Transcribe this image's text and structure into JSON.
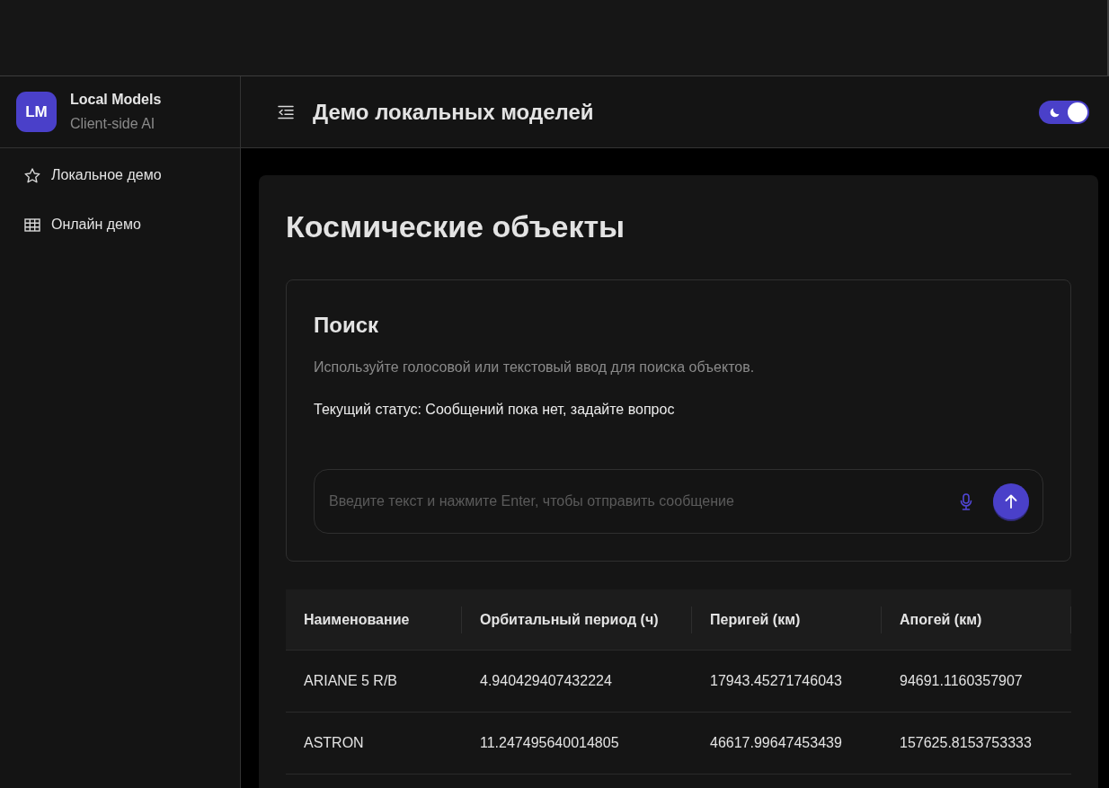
{
  "sidebar": {
    "logo": {
      "initials": "LM",
      "title": "Local Models",
      "subtitle": "Client-side AI"
    },
    "items": [
      {
        "label": "Локальное демо"
      },
      {
        "label": "Онлайн демо"
      }
    ]
  },
  "header": {
    "title": "Демо локальных моделей",
    "theme_toggle": {
      "on": true
    }
  },
  "page": {
    "heading": "Космические объекты",
    "search": {
      "title": "Поиск",
      "description": "Используйте голосовой или текстовый ввод для поиска объектов.",
      "status": "Текущий статус: Сообщений пока нет, задайте вопрос",
      "input": {
        "placeholder": "Введите текст и нажмите Enter, чтобы отправить сообщение"
      }
    },
    "table": {
      "columns": [
        "Наименование",
        "Орбитальный период (ч)",
        "Перигей (км)",
        "Апогей (км)"
      ],
      "rows": [
        [
          "ARIANE 5 R/B",
          "4.940429407432224",
          "17943.45271746043",
          "94691.1160357907"
        ],
        [
          "ASTRON",
          "11.247495640014805",
          "46617.99647453439",
          "157625.8153753333"
        ]
      ]
    }
  }
}
